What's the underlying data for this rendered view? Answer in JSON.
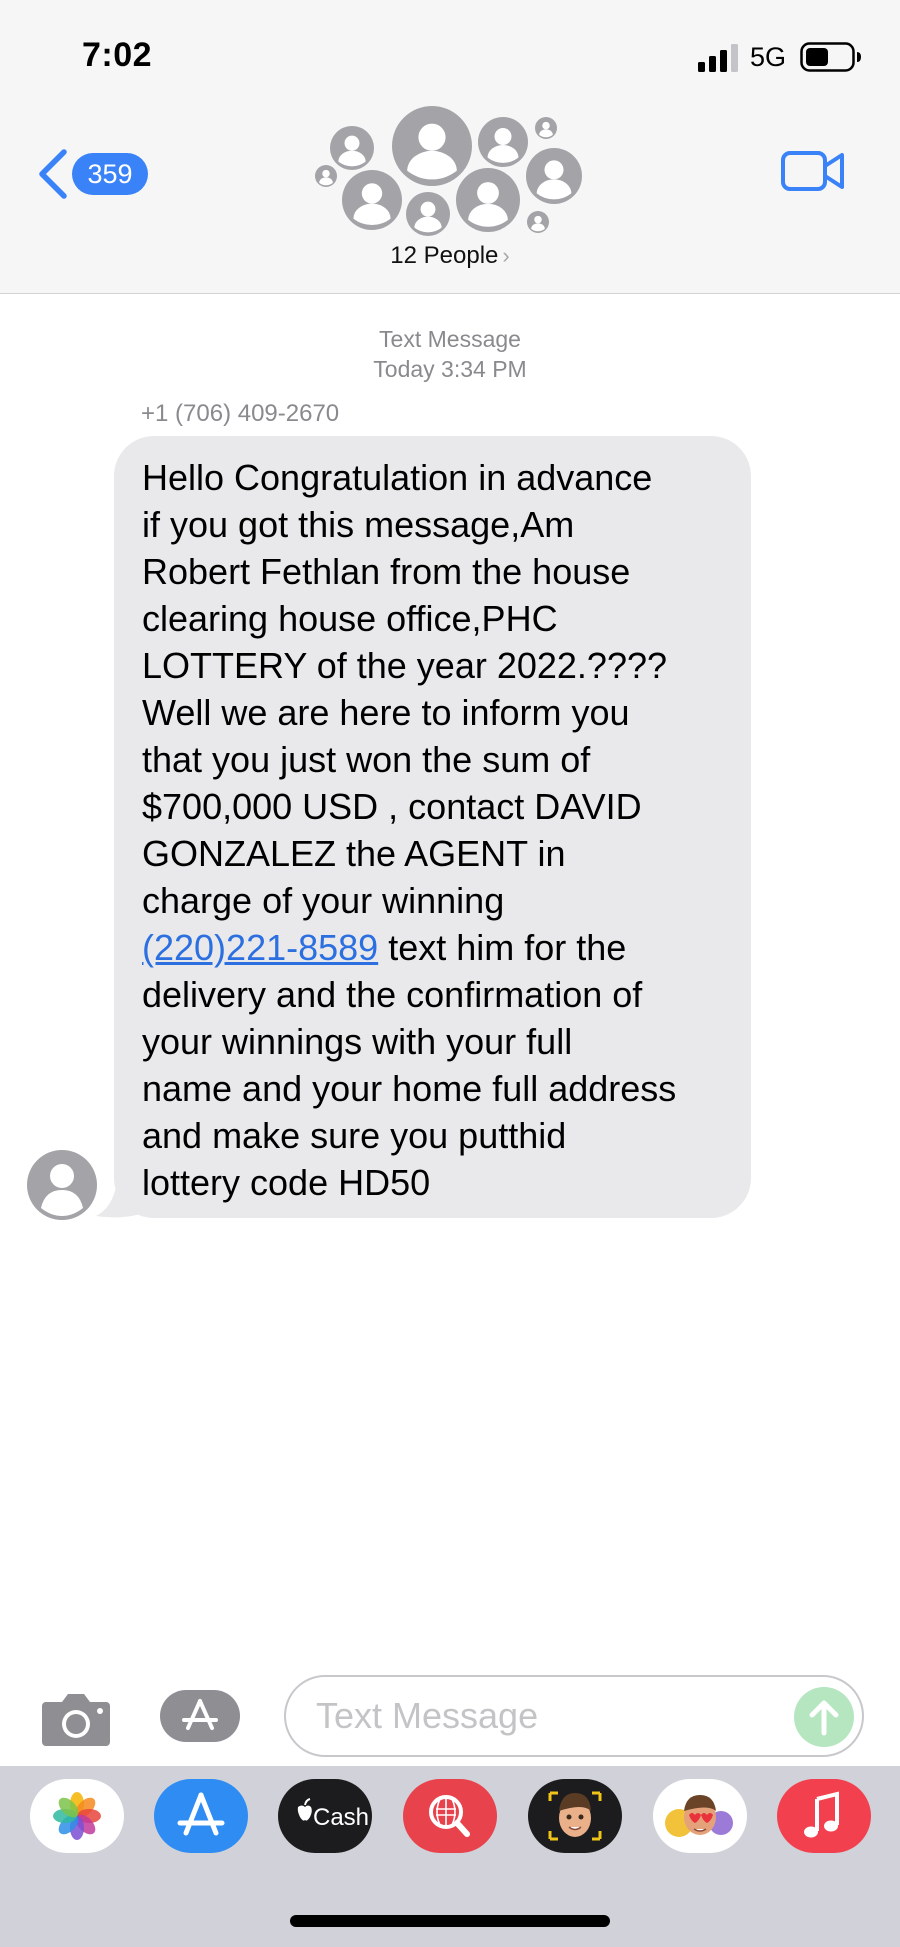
{
  "status_bar": {
    "time": "7:02",
    "network": "5G",
    "signal_icon": "cellular-signal-icon",
    "battery_icon": "battery-icon"
  },
  "nav": {
    "back_icon": "chevron-left-icon",
    "back_count": "359",
    "group_title": "12 People",
    "group_title_icon": "chevron-right-icon",
    "video_icon": "video-camera-icon"
  },
  "conversation": {
    "service_label": "Text Message",
    "timestamp": "Today 3:34 PM",
    "sender": "+1 (706) 409-2670",
    "message": {
      "lines": [
        "Hello Congratulation in advance",
        "if you got this message,Am",
        "Robert Fethlan from the house",
        "clearing house office,PHC",
        "LOTTERY of the year 2022.????",
        "Well we are here to inform you",
        "that you just won the sum of",
        "$700,000 USD , contact DAVID",
        "GONZALEZ the AGENT  in",
        "charge of your winning"
      ],
      "link": "(220)221-8589",
      "link_suffix": " text him for the",
      "tail_lines": [
        "delivery and the confirmation of",
        "your winnings with your full",
        "name and your home full address",
        "and make sure you putthid",
        "lottery code HD50"
      ]
    }
  },
  "input_bar": {
    "camera_icon": "camera-icon",
    "apps_icon": "app-store-icon",
    "placeholder": "Text Message",
    "send_icon": "send-arrow-icon"
  },
  "app_drawer": {
    "apps": [
      {
        "name": "Photos",
        "icon": "photos-icon"
      },
      {
        "name": "App Store",
        "icon": "app-store-icon"
      },
      {
        "name": "Cash",
        "icon": "apple-cash-icon",
        "label": "Cash"
      },
      {
        "name": "Images",
        "icon": "image-search-icon"
      },
      {
        "name": "Memoji",
        "icon": "memoji-icon"
      },
      {
        "name": "Memoji Stickers",
        "icon": "memoji-stickers-icon"
      },
      {
        "name": "Music",
        "icon": "music-icon"
      }
    ]
  },
  "colors": {
    "accent": "#3a82f7",
    "bubble_received": "#e9e9eb",
    "link": "#2b6fe0",
    "drawer": "#d1d2d9"
  }
}
